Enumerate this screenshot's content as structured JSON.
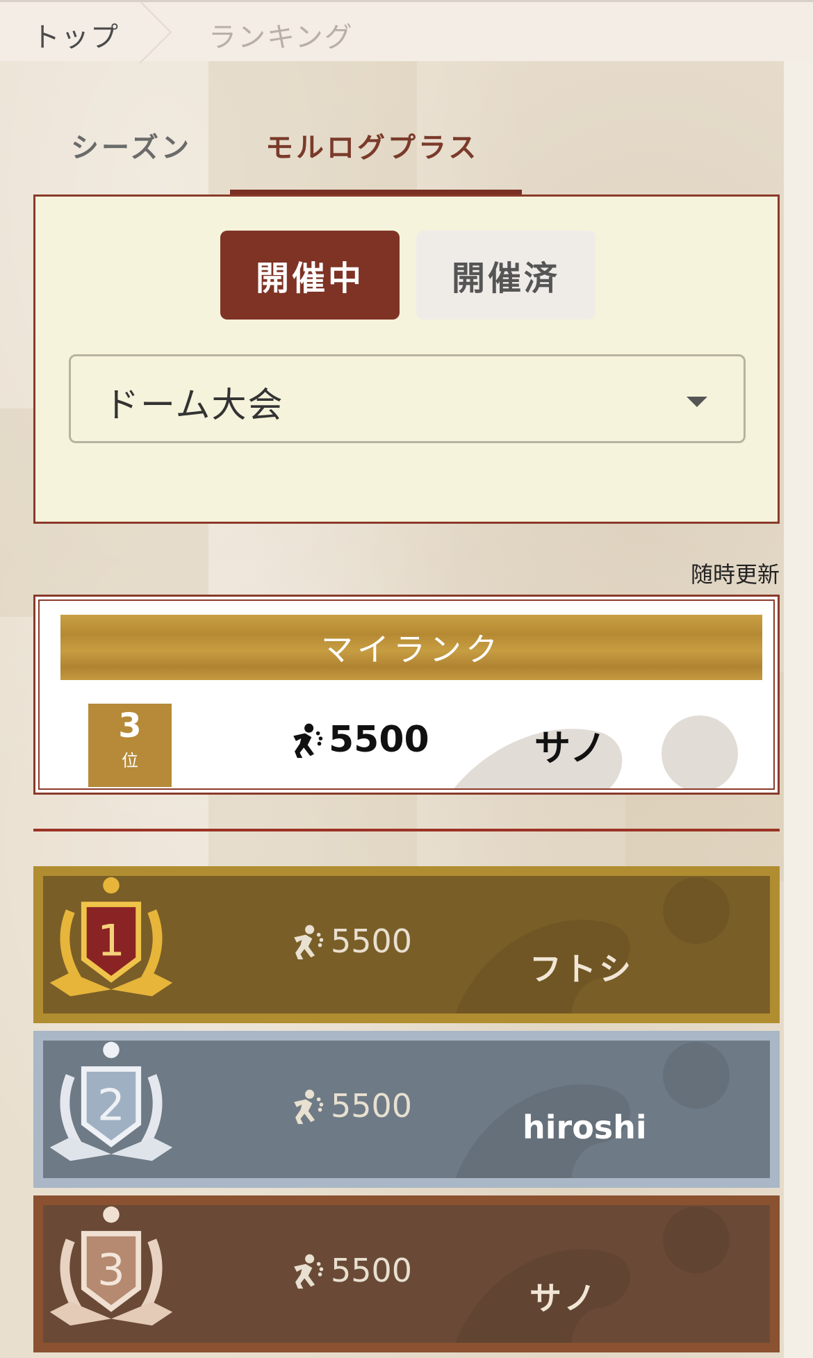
{
  "breadcrumb": {
    "home": "トップ",
    "current": "ランキング"
  },
  "tabs": {
    "season": "シーズン",
    "plus": "モルログプラス"
  },
  "filter": {
    "active_label": "開催中",
    "inactive_label": "開催済",
    "select_value": "ドーム大会"
  },
  "update_note": "随時更新",
  "my_rank": {
    "header": "マイランク",
    "rank": "3",
    "rank_suffix": "位",
    "score": "5500",
    "name": "サノ"
  },
  "rankings": [
    {
      "rank": "1",
      "score": "5500",
      "name": "フトシ",
      "medal": "gold-medal-icon"
    },
    {
      "rank": "2",
      "score": "5500",
      "name": "hiroshi",
      "medal": "silver-medal-icon"
    },
    {
      "rank": "3",
      "score": "5500",
      "name": "サノ",
      "medal": "bronze-medal-icon"
    }
  ],
  "colors": {
    "accent": "#7e3325",
    "gold": "#b08d30",
    "silver": "#a9b7c6",
    "bronze": "#8a5230",
    "panel_bg": "#f6f3dc"
  }
}
